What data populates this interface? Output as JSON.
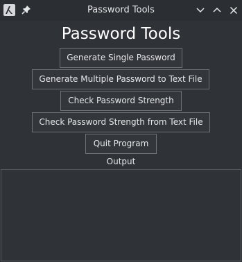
{
  "window": {
    "title": "Password Tools",
    "icons": {
      "app": "app-logo-icon",
      "pin": "pin-icon",
      "minimize": "chevron-down-icon",
      "maximize": "chevron-up-icon",
      "close": "close-icon"
    }
  },
  "main": {
    "heading": "Password Tools",
    "buttons": [
      {
        "label": "Generate Single Password"
      },
      {
        "label": "Generate Multiple Password to Text File"
      },
      {
        "label": "Check Password Strength"
      },
      {
        "label": "Check Password Strength from Text File"
      },
      {
        "label": "Quit Program"
      }
    ],
    "output_label": "Output",
    "output_text": ""
  },
  "colors": {
    "background": "#2f3237",
    "titlebar": "#2b2e32",
    "button_border": "#6f7378",
    "text": "#e8e9ea"
  }
}
